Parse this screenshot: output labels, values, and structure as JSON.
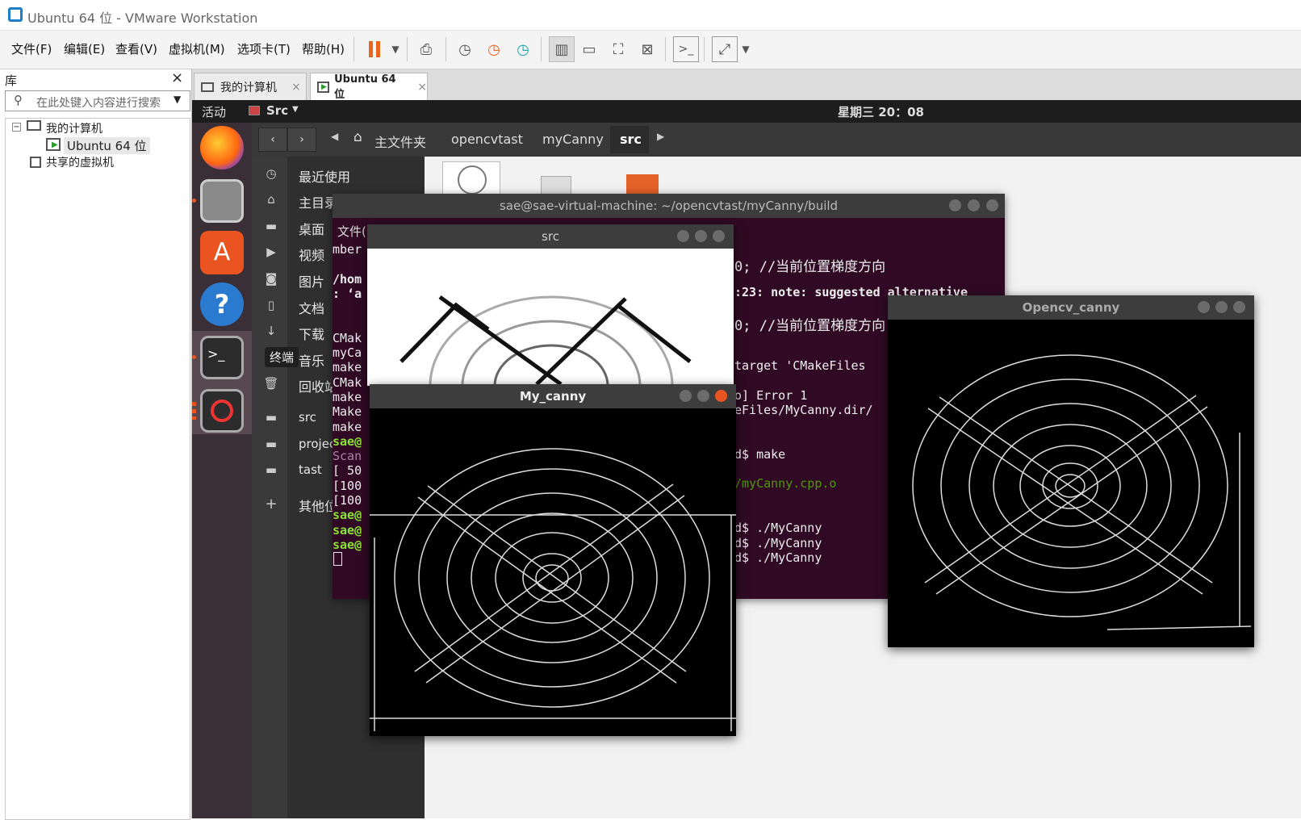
{
  "window": {
    "title": "Ubuntu 64 位 - VMware Workstation"
  },
  "menu": [
    "文件(F)",
    "编辑(E)",
    "查看(V)",
    "虚拟机(M)",
    "选项卡(T)",
    "帮助(H)"
  ],
  "library": {
    "title": "库",
    "search_placeholder": "在此处键入内容进行搜索",
    "tree": [
      "我的计算机",
      "Ubuntu 64 位",
      "共享的虚拟机"
    ]
  },
  "tabs": [
    "我的计算机",
    "Ubuntu 64 位"
  ],
  "ubuntu": {
    "activities": "活动",
    "app": "Src",
    "clock": "星期三 20：08",
    "tooltip": "终端",
    "path": [
      "主文件夹",
      "opencvtast",
      "myCanny",
      "src"
    ],
    "sidebar": [
      "最近使用",
      "主目录",
      "桌面",
      "视频",
      "图片",
      "文档",
      "下载",
      "音乐",
      "回收站",
      "src",
      "project",
      "tast",
      "其他位置"
    ]
  },
  "terminal": {
    "title": "sae@sae-virtual-machine: ~/opencvtast/myCanny/build",
    "file_menu": "文件(",
    "left": [
      "mber",
      "",
      "/hom",
      ": ‘a",
      "",
      "",
      "CMak",
      "myCa",
      "make",
      "CMak",
      "make",
      "Make",
      "make",
      "sae@",
      "Scan",
      "[ 50",
      "[100",
      "[100",
      "sae@",
      "sae@",
      "sae@"
    ],
    "right": [
      "0; //当前位置梯度方向",
      ":23: note: suggested alternative",
      "0; //当前位置梯度方向",
      "",
      "target 'CMakeFiles",
      "",
      "o] Error 1",
      "eFiles/MyCanny.dir/",
      "",
      "",
      "d$ make",
      "",
      "/myCanny.cpp.o",
      "",
      "",
      "d$ ./MyCanny",
      "d$ ./MyCanny",
      "d$ ./MyCanny"
    ]
  },
  "windows": {
    "src": "src",
    "mycanny": "My_canny",
    "opencv": "Opencv_canny"
  },
  "colors": {
    "ubuntu_orange": "#e95420",
    "terminal_bg": "#300a24",
    "prompt_green": "#8ae234",
    "note_cyan": "#34e2e2"
  }
}
